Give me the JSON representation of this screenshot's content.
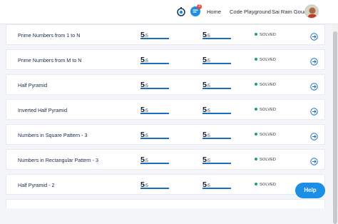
{
  "header": {
    "nav": [
      "Home",
      "Code Playground"
    ],
    "user_name": "Sai Ram Goud",
    "notification_count": "3",
    "icons": [
      "timer-icon",
      "chat-icon"
    ]
  },
  "rows": [
    {
      "name": "Prime Numbers from 1 to N",
      "score1": "5",
      "score1_total": "/5",
      "score2": "5",
      "score2_total": "/5",
      "status": "SOLVED"
    },
    {
      "name": "Prime Numbers from M to N",
      "score1": "5",
      "score1_total": "/5",
      "score2": "5",
      "score2_total": "/5",
      "status": "SOLVED"
    },
    {
      "name": "Half Pyramid",
      "score1": "5",
      "score1_total": "/5",
      "score2": "5",
      "score2_total": "/5",
      "status": "SOLVED"
    },
    {
      "name": "Inverted Half Pyramid",
      "score1": "5",
      "score1_total": "/5",
      "score2": "5",
      "score2_total": "/5",
      "status": "SOLVED"
    },
    {
      "name": "Numbers in Square Pattern - 3",
      "score1": "5",
      "score1_total": "/5",
      "score2": "5",
      "score2_total": "/5",
      "status": "SOLVED"
    },
    {
      "name": "Numbers in Rectangular Pattern - 3",
      "score1": "5",
      "score1_total": "/5",
      "score2": "5",
      "score2_total": "/5",
      "status": "SOLVED"
    },
    {
      "name": "Half Pyramid - 2",
      "score1": "5",
      "score1_total": "/5",
      "score2": "5",
      "score2_total": "/5",
      "status": "SOLVED"
    }
  ],
  "help_label": "Help",
  "colors": {
    "accent": "#1b6fc2",
    "solved": "#1aa36b",
    "help": "#1b8fe6",
    "badge": "#e8463f"
  }
}
